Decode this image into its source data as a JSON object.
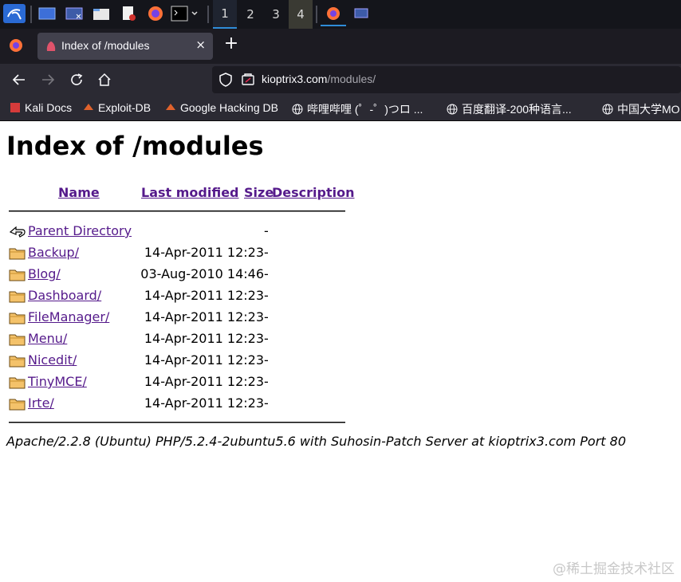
{
  "taskbar": {
    "workspaces": [
      "1",
      "2",
      "3",
      "4"
    ]
  },
  "browser": {
    "tab_title": "Index of /modules",
    "tab_close": "×",
    "new_tab": "+",
    "url_host": "kioptrix3.com",
    "url_path": "/modules/"
  },
  "bookmarks": [
    "Kali Docs",
    "Exploit-DB",
    "Google Hacking DB",
    "哔哩哔哩 (゜-゜)つロ ...",
    "百度翻译-200种语言...",
    "中国大学MO"
  ],
  "page": {
    "title": "Index of /modules",
    "headers": {
      "name": "Name",
      "last_modified": "Last modified",
      "size": "Size",
      "description": "Description"
    },
    "rows": [
      {
        "name": "Parent Directory",
        "date": "",
        "size": "-",
        "icon": "back-icon"
      },
      {
        "name": "Backup/",
        "date": "14-Apr-2011 12:23",
        "size": "-",
        "icon": "folder-icon"
      },
      {
        "name": "Blog/",
        "date": "03-Aug-2010 14:46",
        "size": "-",
        "icon": "folder-icon"
      },
      {
        "name": "Dashboard/",
        "date": "14-Apr-2011 12:23",
        "size": "-",
        "icon": "folder-icon"
      },
      {
        "name": "FileManager/",
        "date": "14-Apr-2011 12:23",
        "size": "-",
        "icon": "folder-icon"
      },
      {
        "name": "Menu/",
        "date": "14-Apr-2011 12:23",
        "size": "-",
        "icon": "folder-icon"
      },
      {
        "name": "Nicedit/",
        "date": "14-Apr-2011 12:23",
        "size": "-",
        "icon": "folder-icon"
      },
      {
        "name": "TinyMCE/",
        "date": "14-Apr-2011 12:23",
        "size": "-",
        "icon": "folder-icon"
      },
      {
        "name": "Irte/",
        "date": "14-Apr-2011 12:23",
        "size": "-",
        "icon": "folder-icon"
      }
    ],
    "footer": "Apache/2.2.8 (Ubuntu) PHP/5.2.4-2ubuntu5.6 with Suhosin-Patch Server at kioptrix3.com Port 80"
  },
  "watermark": "@稀土掘金技术社区",
  "colors": {
    "link": "#551a8b",
    "accent": "#2f8cd8",
    "toolbar": "#2b2a33"
  }
}
